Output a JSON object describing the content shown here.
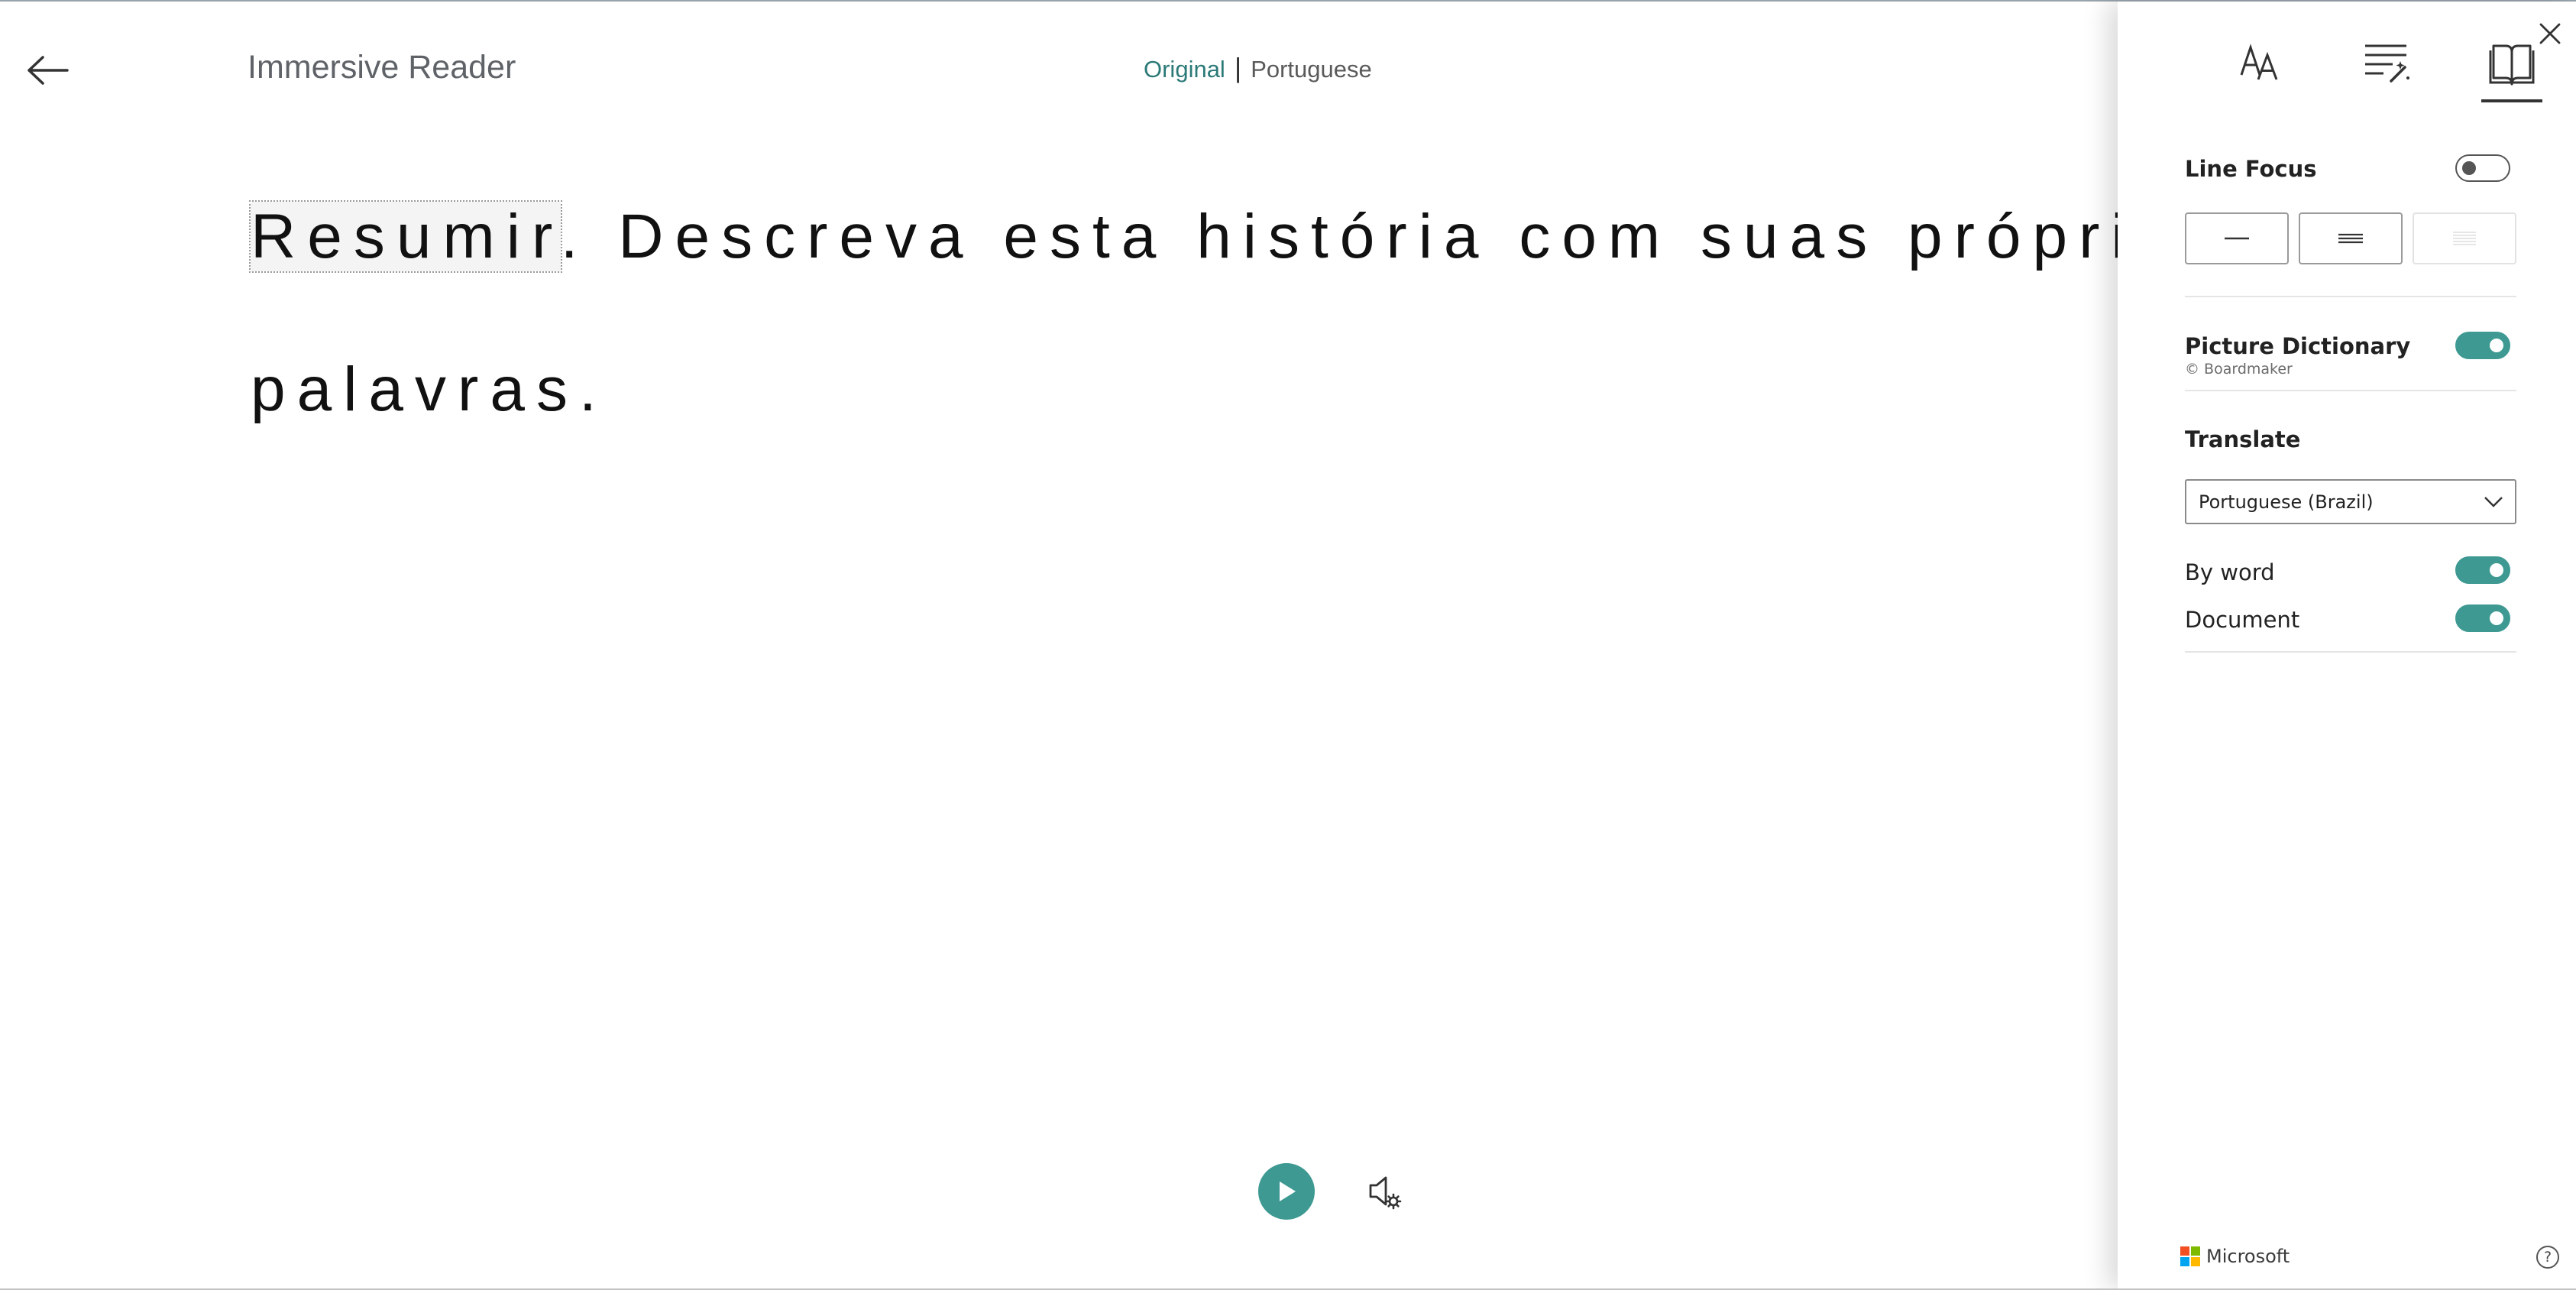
{
  "app": {
    "title": "Immersive Reader"
  },
  "language_switch": {
    "original": "Original",
    "separator": "|",
    "translated": "Portuguese"
  },
  "reader": {
    "focused_word": "Resumir",
    "line1_rest": ". Descreva esta história com suas próprias",
    "line2": "palavras."
  },
  "icons": {
    "back": "arrow-left-icon",
    "play": "play-icon",
    "voice_settings": "speaker-settings-icon",
    "text_preferences": "text-size-icon",
    "grammar_options": "grammar-options-icon",
    "reading_preferences": "book-icon",
    "close": "close-icon",
    "help": "help-icon"
  },
  "panel": {
    "line_focus": {
      "label": "Line Focus",
      "enabled": false,
      "options": [
        "one-line",
        "three-lines",
        "five-lines"
      ]
    },
    "picture_dictionary": {
      "label": "Picture Dictionary",
      "credit": "© Boardmaker",
      "enabled": true
    },
    "translate": {
      "label": "Translate",
      "selected_language": "Portuguese (Brazil)",
      "by_word_label": "By word",
      "by_word_enabled": true,
      "document_label": "Document",
      "document_enabled": true
    },
    "footer": {
      "brand": "Microsoft",
      "help_glyph": "?"
    }
  },
  "colors": {
    "accent": "#3d9992",
    "original_link": "#2b7a78",
    "text": "#111111",
    "ms_red": "#f25022",
    "ms_green": "#7fba00",
    "ms_blue": "#00a4ef",
    "ms_yellow": "#ffb900"
  }
}
